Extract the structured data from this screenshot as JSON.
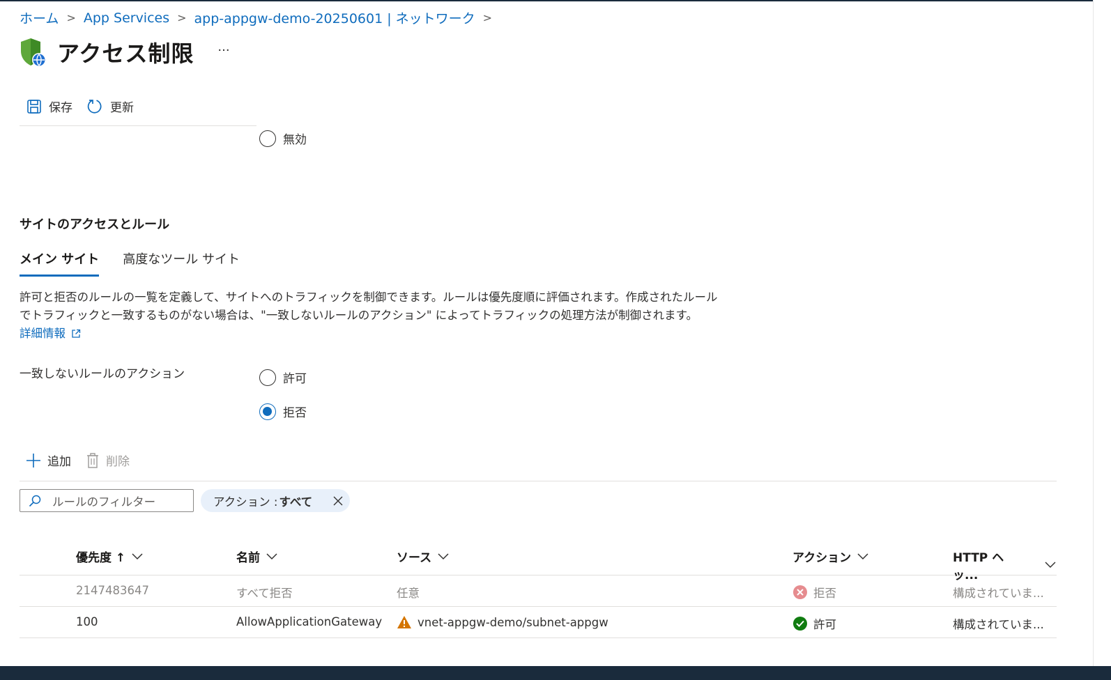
{
  "breadcrumb": {
    "home": "ホーム",
    "app_services": "App Services",
    "resource": "app-appgw-demo-20250601 | ネットワーク",
    "sep": ">"
  },
  "header": {
    "title": "アクセス制限",
    "more": "···"
  },
  "toolbar": {
    "save_label": "保存",
    "refresh_label": "更新"
  },
  "public_access": {
    "disabled_label": "無効",
    "disabled_checked": false
  },
  "section": {
    "title": "サイトのアクセスとルール"
  },
  "tabs": [
    {
      "label": "メイン サイト",
      "active": true
    },
    {
      "label": "高度なツール サイト",
      "active": false
    }
  ],
  "description": {
    "line1": "許可と拒否のルールの一覧を定義して、サイトへのトラフィックを制御できます。ルールは優先度順に評価されます。作成されたルール",
    "line2": "でトラフィックと一致するものがない場合は、\"一致しないルールのアクション\" によってトラフィックの処理方法が制御されます。",
    "learn_more": "詳細情報"
  },
  "unmatched_action": {
    "label": "一致しないルールのアクション",
    "options": [
      {
        "label": "許可",
        "checked": false
      },
      {
        "label": "拒否",
        "checked": true
      }
    ]
  },
  "list_toolbar": {
    "add_label": "追加",
    "delete_label": "削除"
  },
  "filter": {
    "placeholder": "ルールのフィルター",
    "pill_prefix": "アクション : ",
    "pill_value": "すべて"
  },
  "table": {
    "columns": {
      "priority": "優先度 ↑",
      "name": "名前",
      "source": "ソース",
      "action": "アクション",
      "http": "HTTP ヘッ..."
    },
    "rows": [
      {
        "priority": "2147483647",
        "name": "すべて拒否",
        "source": "任意",
        "action": "拒否",
        "http": "構成されていま...",
        "status": "deny",
        "dim": true,
        "warning": false
      },
      {
        "priority": "100",
        "name": "AllowApplicationGateway",
        "source": "vnet-appgw-demo/subnet-appgw",
        "action": "許可",
        "http": "構成されていま...",
        "status": "allow",
        "dim": false,
        "warning": true
      }
    ]
  },
  "colors": {
    "accent": "#0f6cbd",
    "deny": "#d13438",
    "allow": "#107c10",
    "warning": "#d47500"
  }
}
